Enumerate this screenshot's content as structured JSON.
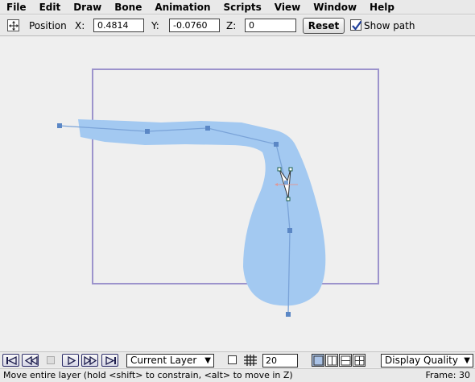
{
  "menu": [
    "File",
    "Edit",
    "Draw",
    "Bone",
    "Animation",
    "Scripts",
    "View",
    "Window",
    "Help"
  ],
  "toolbar": {
    "tool_icon": "transform-layer-icon",
    "position_label": "Position",
    "x_label": "X:",
    "x_value": "0.4814",
    "y_label": "Y:",
    "y_value": "-0.0760",
    "z_label": "Z:",
    "z_value": "0",
    "reset_label": "Reset",
    "show_path_label": "Show path",
    "show_path_checked": true
  },
  "canvas": {
    "background": "#efefef",
    "frame_border_color": "#9c93cc",
    "shape_fill": "#a3c9f1",
    "path_color": "#7aa3d8",
    "point_color": "#5b87c5"
  },
  "playback": {
    "buttons": [
      "rewind-to-start-icon",
      "step-back-icon",
      "stop-icon",
      "play-icon",
      "step-forward-icon",
      "forward-to-end-icon"
    ],
    "layer_select": "Current Layer",
    "onion_frames": "20",
    "display_quality": "Display Quality"
  },
  "status": {
    "message": "Move entire layer (hold <shift> to constrain, <alt> to move in Z)",
    "frame": "Frame: 30"
  }
}
